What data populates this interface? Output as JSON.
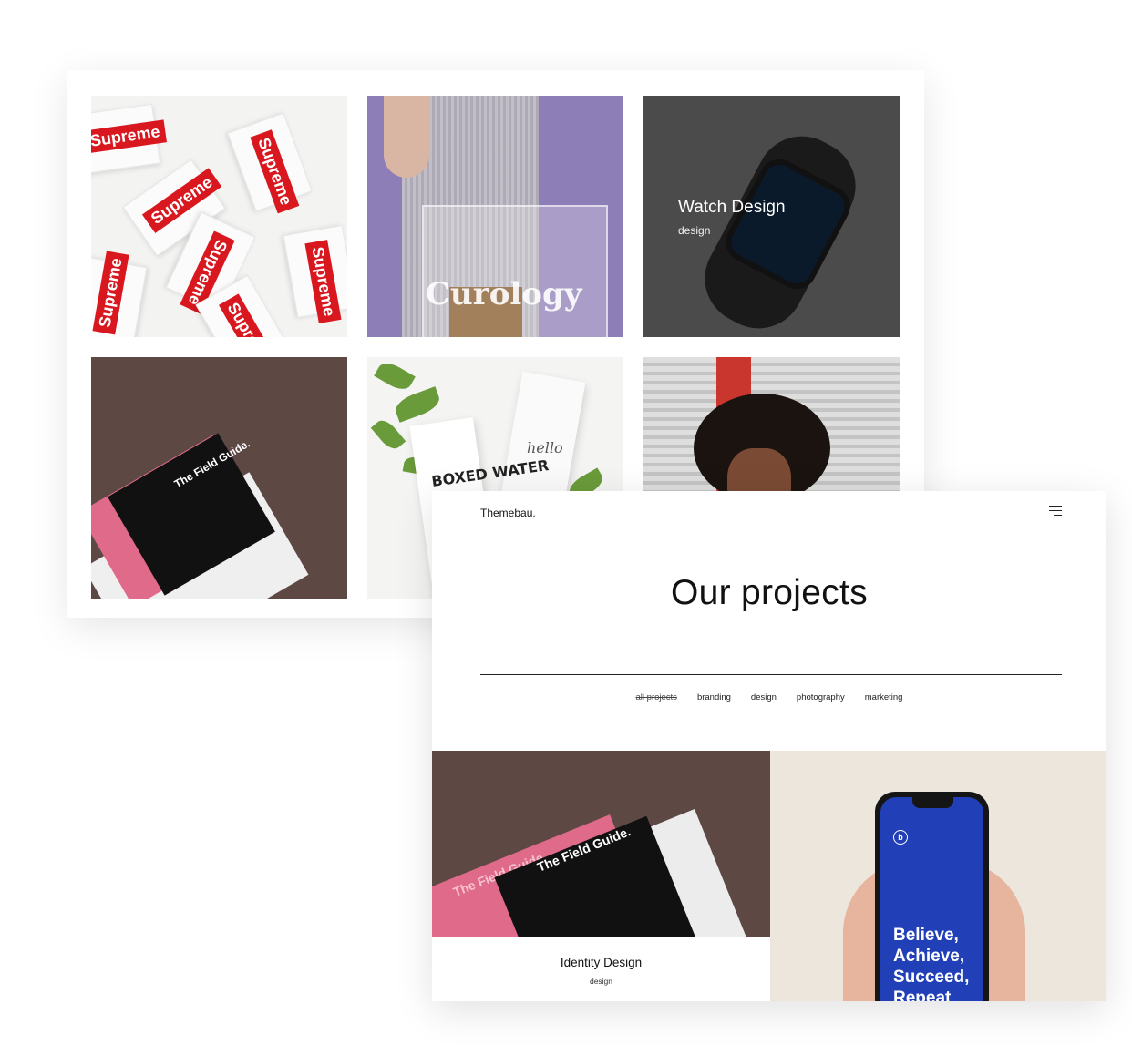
{
  "back_grid": {
    "tiles": [
      {
        "name": "supreme-stickers",
        "sticker_text": "Supreme"
      },
      {
        "name": "curology-bag",
        "bag_text": "Curology"
      },
      {
        "name": "watch-design",
        "title": "Watch Design",
        "category": "design"
      },
      {
        "name": "field-guide",
        "book_title": "The Field Guide."
      },
      {
        "name": "boxed-water",
        "carton_text": "BOXED WATER",
        "carton_script": "hello"
      },
      {
        "name": "portrait"
      }
    ]
  },
  "front": {
    "brand": "Themebau.",
    "menu_icon": "hamburger-icon",
    "page_title": "Our projects",
    "filters": [
      "all projects",
      "branding",
      "design",
      "photography",
      "marketing"
    ],
    "active_filter": "all projects",
    "projects": [
      {
        "title": "Identity Design",
        "category": "design",
        "book_title": "The Field Guide.",
        "book_title_back": "The Field Guide"
      },
      {
        "phone_text_lines": [
          "Believe,",
          "Achieve,",
          "Succeed,",
          "Repeat"
        ],
        "logo": "b"
      }
    ]
  }
}
